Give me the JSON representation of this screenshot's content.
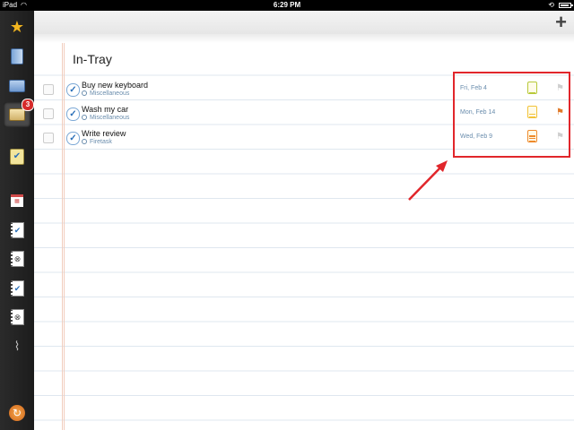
{
  "status_bar": {
    "device": "iPad",
    "time": "6:29 PM"
  },
  "sidebar": {
    "items": [
      {
        "name": "starred-icon"
      },
      {
        "name": "projects-icon"
      },
      {
        "name": "folder-icon"
      },
      {
        "name": "in-tray-icon",
        "badge": "3",
        "active": true
      },
      {
        "name": "next-actions-icon"
      },
      {
        "name": "calendar-icon"
      },
      {
        "name": "completed-notebook-icon"
      },
      {
        "name": "trash-notebook-icon"
      },
      {
        "name": "completed-notebook-2-icon"
      },
      {
        "name": "deleted-notebook-icon"
      },
      {
        "name": "spring-icon"
      },
      {
        "name": "sync-icon"
      }
    ]
  },
  "header": {
    "add_label": "+"
  },
  "list": {
    "title": "In-Tray",
    "tasks": [
      {
        "title": "Buy new keyboard",
        "context": "Miscellaneous",
        "date": "Fri, Feb 4",
        "priority_color": "#b8c93a",
        "flag_color": "#cfcfcf"
      },
      {
        "title": "Wash my car",
        "context": "Miscellaneous",
        "date": "Mon, Feb 14",
        "priority_color": "#f2c33a",
        "flag_color": "#e07a2a"
      },
      {
        "title": "Write review",
        "context": "Firetask",
        "date": "Wed, Feb 9",
        "priority_color": "#ee8a2c",
        "flag_color": "#cfcfcf"
      }
    ]
  },
  "annotation": {
    "color": "#e1262b"
  }
}
